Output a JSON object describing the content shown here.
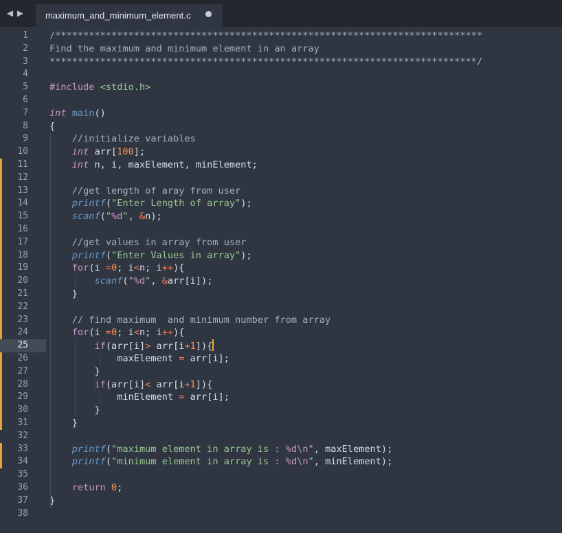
{
  "tab": {
    "title": "maximum_and_minimum_element.c",
    "modified": true
  },
  "editor": {
    "active_line": 25,
    "lines": [
      [
        {
          "t": "/****************************************************************************",
          "c": "c-comment"
        }
      ],
      [
        {
          "t": "Find the maximum and minimum element in an array",
          "c": "c-comment"
        }
      ],
      [
        {
          "t": "****************************************************************************/",
          "c": "c-comment"
        }
      ],
      [],
      [
        {
          "t": "#include",
          "c": "c-inc"
        },
        {
          "t": " ",
          "c": "c-punc"
        },
        {
          "t": "<stdio.h>",
          "c": "c-hdr"
        }
      ],
      [],
      [
        {
          "t": "int",
          "c": "c-type"
        },
        {
          "t": " ",
          "c": "c-punc"
        },
        {
          "t": "main",
          "c": "c-fn"
        },
        {
          "t": "()",
          "c": "c-punc"
        }
      ],
      [
        {
          "t": "{",
          "c": "c-punc"
        }
      ],
      [
        {
          "t": "    //initialize variables",
          "c": "c-comment"
        }
      ],
      [
        {
          "t": "    ",
          "c": "c-punc"
        },
        {
          "t": "int",
          "c": "c-type"
        },
        {
          "t": " arr[",
          "c": "c-punc"
        },
        {
          "t": "100",
          "c": "c-num"
        },
        {
          "t": "];",
          "c": "c-punc"
        }
      ],
      [
        {
          "t": "    ",
          "c": "c-punc"
        },
        {
          "t": "int",
          "c": "c-type"
        },
        {
          "t": " n, i, maxElement, minElement;",
          "c": "c-punc"
        }
      ],
      [],
      [
        {
          "t": "    //get length of aray from user",
          "c": "c-comment"
        }
      ],
      [
        {
          "t": "    ",
          "c": "c-punc"
        },
        {
          "t": "printf",
          "c": "c-call"
        },
        {
          "t": "(",
          "c": "c-punc"
        },
        {
          "t": "\"Enter Length of array\"",
          "c": "c-str"
        },
        {
          "t": ");",
          "c": "c-punc"
        }
      ],
      [
        {
          "t": "    ",
          "c": "c-punc"
        },
        {
          "t": "scanf",
          "c": "c-call"
        },
        {
          "t": "(",
          "c": "c-punc"
        },
        {
          "t": "\"",
          "c": "c-str"
        },
        {
          "t": "%d",
          "c": "c-fmt"
        },
        {
          "t": "\"",
          "c": "c-str"
        },
        {
          "t": ", ",
          "c": "c-punc"
        },
        {
          "t": "&",
          "c": "c-op"
        },
        {
          "t": "n);",
          "c": "c-punc"
        }
      ],
      [],
      [
        {
          "t": "    //get values in array from user",
          "c": "c-comment"
        }
      ],
      [
        {
          "t": "    ",
          "c": "c-punc"
        },
        {
          "t": "printf",
          "c": "c-call"
        },
        {
          "t": "(",
          "c": "c-punc"
        },
        {
          "t": "\"Enter Values in array\"",
          "c": "c-str"
        },
        {
          "t": ");",
          "c": "c-punc"
        }
      ],
      [
        {
          "t": "    ",
          "c": "c-punc"
        },
        {
          "t": "for",
          "c": "c-kw2"
        },
        {
          "t": "(i ",
          "c": "c-punc"
        },
        {
          "t": "=",
          "c": "c-op"
        },
        {
          "t": "0",
          "c": "c-num"
        },
        {
          "t": "; i",
          "c": "c-punc"
        },
        {
          "t": "<",
          "c": "c-op"
        },
        {
          "t": "n; i",
          "c": "c-punc"
        },
        {
          "t": "++",
          "c": "c-op"
        },
        {
          "t": "){",
          "c": "c-punc"
        }
      ],
      [
        {
          "t": "        ",
          "c": "c-punc"
        },
        {
          "t": "scanf",
          "c": "c-call"
        },
        {
          "t": "(",
          "c": "c-punc"
        },
        {
          "t": "\"",
          "c": "c-str"
        },
        {
          "t": "%d",
          "c": "c-fmt"
        },
        {
          "t": "\"",
          "c": "c-str"
        },
        {
          "t": ", ",
          "c": "c-punc"
        },
        {
          "t": "&",
          "c": "c-op"
        },
        {
          "t": "arr[i]);",
          "c": "c-punc"
        }
      ],
      [
        {
          "t": "    }",
          "c": "c-punc"
        }
      ],
      [],
      [
        {
          "t": "    // find maximum  and minimum number from array",
          "c": "c-comment"
        }
      ],
      [
        {
          "t": "    ",
          "c": "c-punc"
        },
        {
          "t": "for",
          "c": "c-kw2"
        },
        {
          "t": "(i ",
          "c": "c-punc"
        },
        {
          "t": "=",
          "c": "c-op"
        },
        {
          "t": "0",
          "c": "c-num"
        },
        {
          "t": "; i",
          "c": "c-punc"
        },
        {
          "t": "<",
          "c": "c-op"
        },
        {
          "t": "n; i",
          "c": "c-punc"
        },
        {
          "t": "++",
          "c": "c-op"
        },
        {
          "t": "){",
          "c": "c-punc"
        }
      ],
      [
        {
          "t": "        ",
          "c": "c-punc"
        },
        {
          "t": "if",
          "c": "c-kw2"
        },
        {
          "t": "(arr[i]",
          "c": "c-punc"
        },
        {
          "t": ">",
          "c": "c-op"
        },
        {
          "t": " arr[i",
          "c": "c-punc"
        },
        {
          "t": "+",
          "c": "c-op"
        },
        {
          "t": "1",
          "c": "c-num"
        },
        {
          "t": "]){",
          "c": "c-punc"
        },
        {
          "t": "",
          "c": "cursor"
        }
      ],
      [
        {
          "t": "            maxElement ",
          "c": "c-punc"
        },
        {
          "t": "=",
          "c": "c-op"
        },
        {
          "t": " arr[i];",
          "c": "c-punc"
        }
      ],
      [
        {
          "t": "        }",
          "c": "c-punc"
        }
      ],
      [
        {
          "t": "        ",
          "c": "c-punc"
        },
        {
          "t": "if",
          "c": "c-kw2"
        },
        {
          "t": "(arr[i]",
          "c": "c-punc"
        },
        {
          "t": "<",
          "c": "c-op"
        },
        {
          "t": " arr[i",
          "c": "c-punc"
        },
        {
          "t": "+",
          "c": "c-op"
        },
        {
          "t": "1",
          "c": "c-num"
        },
        {
          "t": "]){",
          "c": "c-punc"
        }
      ],
      [
        {
          "t": "            minElement ",
          "c": "c-punc"
        },
        {
          "t": "=",
          "c": "c-op"
        },
        {
          "t": " arr[i];",
          "c": "c-punc"
        }
      ],
      [
        {
          "t": "        }",
          "c": "c-punc"
        }
      ],
      [
        {
          "t": "    }",
          "c": "c-punc"
        }
      ],
      [],
      [
        {
          "t": "    ",
          "c": "c-punc"
        },
        {
          "t": "printf",
          "c": "c-call"
        },
        {
          "t": "(",
          "c": "c-punc"
        },
        {
          "t": "\"maximum element in array is : ",
          "c": "c-str"
        },
        {
          "t": "%d",
          "c": "c-fmt"
        },
        {
          "t": "\\n",
          "c": "c-fmt"
        },
        {
          "t": "\"",
          "c": "c-str"
        },
        {
          "t": ", maxElement);",
          "c": "c-punc"
        }
      ],
      [
        {
          "t": "    ",
          "c": "c-punc"
        },
        {
          "t": "printf",
          "c": "c-call"
        },
        {
          "t": "(",
          "c": "c-punc"
        },
        {
          "t": "\"minimum element in array is : ",
          "c": "c-str"
        },
        {
          "t": "%d",
          "c": "c-fmt"
        },
        {
          "t": "\\n",
          "c": "c-fmt"
        },
        {
          "t": "\"",
          "c": "c-str"
        },
        {
          "t": ", minElement);",
          "c": "c-punc"
        }
      ],
      [],
      [
        {
          "t": "    ",
          "c": "c-punc"
        },
        {
          "t": "return",
          "c": "c-kw2"
        },
        {
          "t": " ",
          "c": "c-punc"
        },
        {
          "t": "0",
          "c": "c-num"
        },
        {
          "t": ";",
          "c": "c-punc"
        }
      ],
      [
        {
          "t": "}",
          "c": "c-punc"
        }
      ],
      []
    ],
    "modified_ranges": [
      [
        11,
        31
      ],
      [
        33,
        34
      ]
    ]
  }
}
